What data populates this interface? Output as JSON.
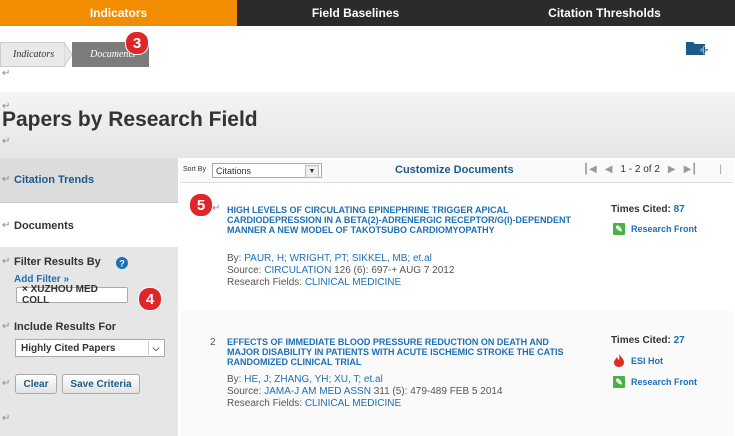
{
  "tabs": [
    "Indicators",
    "Field Baselines",
    "Citation Thresholds"
  ],
  "breadcrumb": [
    "Indicators",
    "Documents"
  ],
  "annotations": [
    "3",
    "4",
    "5"
  ],
  "page_title": "Papers by Research Field",
  "sidebar": {
    "citation_trends": "Citation Trends",
    "documents": "Documents",
    "filter_label": "Filter Results By",
    "add_filter": "Add Filter »",
    "filter_chip": "× XUZHOU MED COLL",
    "include_label": "Include Results For",
    "include_value": "Highly Cited Papers",
    "clear": "Clear",
    "save": "Save Criteria"
  },
  "toolbar": {
    "sort_label": "Sort By",
    "sort_value": "Citations",
    "customize": "Customize Documents",
    "page_info": "1 - 2 of 2"
  },
  "records": [
    {
      "number": "",
      "title": "HIGH LEVELS OF CIRCULATING EPINEPHRINE TRIGGER APICAL CARDIODEPRESSION IN A BETA(2)-ADRENERGIC RECEPTOR/G(I)-DEPENDENT MANNER A NEW MODEL OF TAKOTSUBO CARDIOMYOPATHY",
      "by_label": "By:",
      "authors": "PAUR, H;   WRIGHT, PT;   SIKKEL, MB;   et.al",
      "source_label": "Source:",
      "source": "CIRCULATION",
      "source_detail": " 126 (6): 697-+ AUG 7 2012",
      "fields_label": "Research Fields:",
      "fields": "CLINICAL MEDICINE",
      "times_cited_label": "Times Cited:",
      "times_cited": "87",
      "links": [
        "Research Front"
      ]
    },
    {
      "number": "2",
      "title": "EFFECTS OF IMMEDIATE BLOOD PRESSURE REDUCTION ON DEATH AND MAJOR DISABILITY IN PATIENTS WITH ACUTE ISCHEMIC STROKE THE CATIS RANDOMIZED CLINICAL TRIAL",
      "by_label": "By:",
      "authors": "HE, J;   ZHANG, YH;   XU, T;   et.al",
      "source_label": "Source:",
      "source": "JAMA-J AM MED ASSN",
      "source_detail": " 311 (5): 479-489 FEB 5 2014",
      "fields_label": "Research Fields:",
      "fields": "CLINICAL MEDICINE",
      "times_cited_label": "Times Cited:",
      "times_cited": "27",
      "links": [
        "ESI Hot",
        "Research Front"
      ]
    }
  ],
  "colors": {
    "accent_orange": "#f28c00",
    "dark_tab": "#2b2b2b",
    "link_blue": "#1c6fb8",
    "badge_red": "#e0262b"
  }
}
